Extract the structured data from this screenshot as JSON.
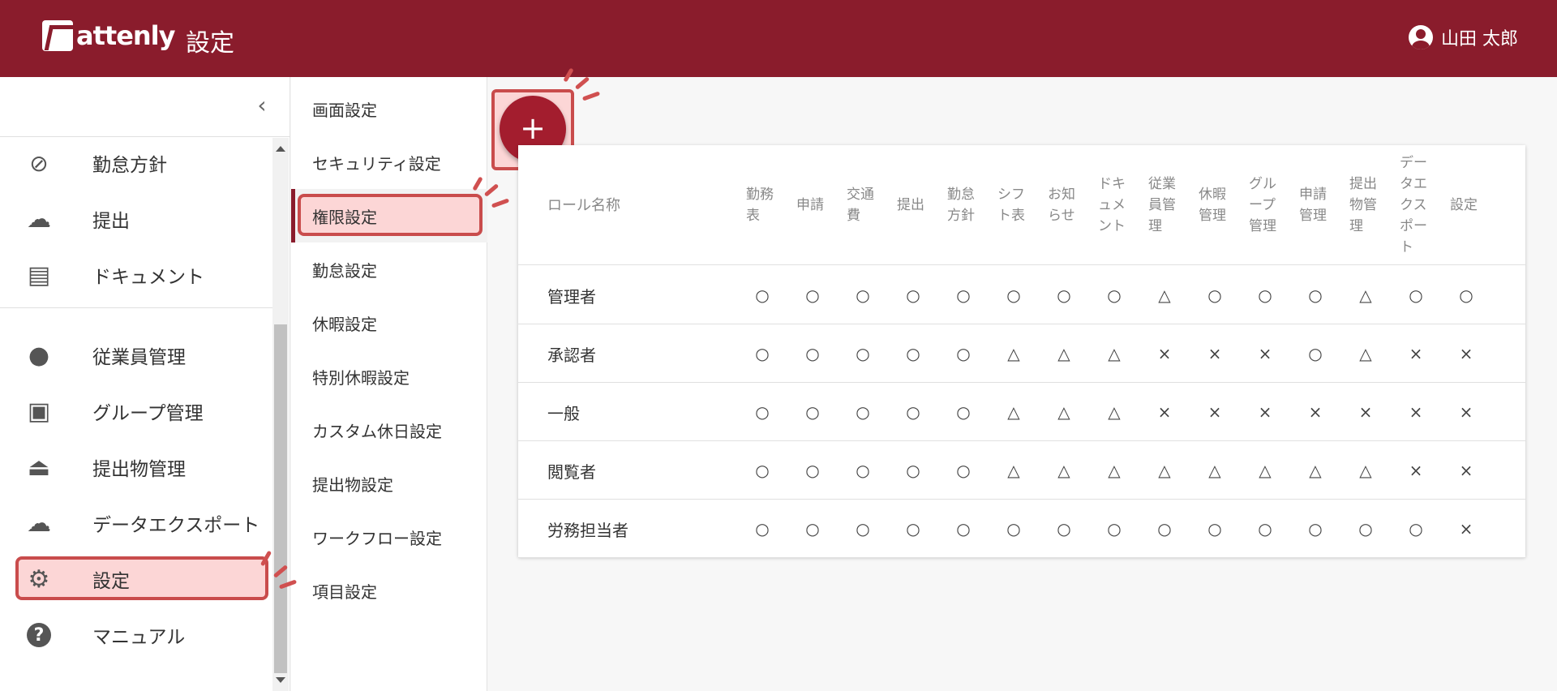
{
  "header": {
    "logo_text": "attenly",
    "title": "設定",
    "user_name": "山田 太郎"
  },
  "sidebar": {
    "items": [
      {
        "label": "勤怠方針",
        "icon": "compass-icon"
      },
      {
        "label": "提出",
        "icon": "cloud-upload-icon"
      },
      {
        "label": "ドキュメント",
        "icon": "document-list-icon"
      },
      {
        "label": "従業員管理",
        "icon": "person-icon"
      },
      {
        "label": "グループ管理",
        "icon": "group-frame-icon"
      },
      {
        "label": "提出物管理",
        "icon": "stamp-icon"
      },
      {
        "label": "データエクスポート",
        "icon": "cloud-download-icon"
      },
      {
        "label": "設定",
        "icon": "gear-icon",
        "active": true
      },
      {
        "label": "マニュアル",
        "icon": "help-icon"
      }
    ]
  },
  "settings_menu": {
    "items": [
      {
        "label": "画面設定"
      },
      {
        "label": "セキュリティ設定"
      },
      {
        "label": "権限設定",
        "active": true
      },
      {
        "label": "勤怠設定"
      },
      {
        "label": "休暇設定"
      },
      {
        "label": "特別休暇設定"
      },
      {
        "label": "カスタム休日設定"
      },
      {
        "label": "提出物設定"
      },
      {
        "label": "ワークフロー設定"
      },
      {
        "label": "項目設定"
      }
    ]
  },
  "fab": {
    "label": "+"
  },
  "table": {
    "role_header": "ロール名称",
    "columns": [
      "勤務表",
      "申請",
      "交通費",
      "提出",
      "勤怠方針",
      "シフト表",
      "お知らせ",
      "ドキュメント",
      "従業員管理",
      "休暇管理",
      "グループ管理",
      "申請管理",
      "提出物管理",
      "データエクスポート",
      "設定"
    ],
    "rows": [
      {
        "name": "管理者",
        "values": [
          "○",
          "○",
          "○",
          "○",
          "○",
          "○",
          "○",
          "○",
          "△",
          "○",
          "○",
          "○",
          "△",
          "○",
          "○"
        ]
      },
      {
        "name": "承認者",
        "values": [
          "○",
          "○",
          "○",
          "○",
          "○",
          "△",
          "△",
          "△",
          "×",
          "×",
          "×",
          "○",
          "△",
          "×",
          "×"
        ]
      },
      {
        "name": "一般",
        "values": [
          "○",
          "○",
          "○",
          "○",
          "○",
          "△",
          "△",
          "△",
          "×",
          "×",
          "×",
          "×",
          "×",
          "×",
          "×"
        ]
      },
      {
        "name": "閲覧者",
        "values": [
          "○",
          "○",
          "○",
          "○",
          "○",
          "△",
          "△",
          "△",
          "△",
          "△",
          "△",
          "△",
          "△",
          "×",
          "×"
        ]
      },
      {
        "name": "労務担当者",
        "values": [
          "○",
          "○",
          "○",
          "○",
          "○",
          "○",
          "○",
          "○",
          "○",
          "○",
          "○",
          "○",
          "○",
          "○",
          "×"
        ]
      }
    ]
  },
  "colors": {
    "brand": "#8a1c2c",
    "fab": "#a31d2e",
    "highlight_border": "#c94c4c",
    "highlight_fill": "#fcd6d6"
  }
}
